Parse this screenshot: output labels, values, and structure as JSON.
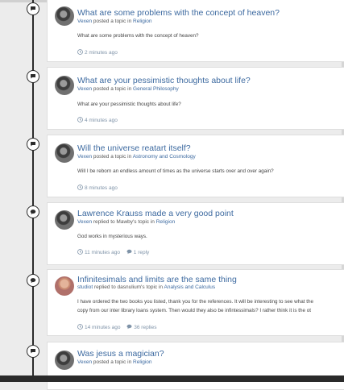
{
  "activity": [
    {
      "type": "topic",
      "avatar": "vexen",
      "title": "What are some problems with the concept of heaven?",
      "author": "Vexen",
      "action": "posted a topic in",
      "forum": "Religion",
      "excerpt": [
        "What are some problems with the concept of heaven?"
      ],
      "time": "2 minutes ago"
    },
    {
      "type": "topic",
      "avatar": "vexen",
      "title": "What are your pessimistic thoughts about life?",
      "author": "Vexen",
      "action": "posted a topic in",
      "forum": "General Philosophy",
      "excerpt": [
        "What are your pessimistic thoughts about life?"
      ],
      "time": "4 minutes ago"
    },
    {
      "type": "topic",
      "avatar": "vexen",
      "title": "Will the universe reatart itself?",
      "author": "Vexen",
      "action": "posted a topic in",
      "forum": "Astronomy and Cosmology",
      "excerpt": [
        "Will I be reborn an endless amount of times as the universe starts over and over again?"
      ],
      "time": "8 minutes ago"
    },
    {
      "type": "reply",
      "avatar": "vexen",
      "title": "Lawrence Krauss made a very good point",
      "author": "Vexen",
      "action": "replied to Mawby's topic in",
      "forum": "Religion",
      "excerpt": [
        "God works in mysterious ways."
      ],
      "time": "11 minutes ago",
      "replies": "1 reply"
    },
    {
      "type": "reply",
      "avatar": "studiot",
      "title": "Infinitesimals and limits are the same thing",
      "author": "studiot",
      "action": "replied to dasnulium's topic in",
      "forum": "Analysis and Calculus",
      "excerpt": [
        "I have ordered the two books you listed, thank you for the references. It will be interesting to see what the",
        "copy from our inter library loans system. Then would they also be infintessimals? I rather think it is the ot"
      ],
      "time": "14 minutes ago",
      "replies": "36 replies"
    },
    {
      "type": "topic",
      "avatar": "vexen",
      "title": "Was jesus a magician?",
      "author": "Vexen",
      "action": "posted a topic in",
      "forum": "Religion",
      "excerpt": [],
      "time": ""
    }
  ]
}
